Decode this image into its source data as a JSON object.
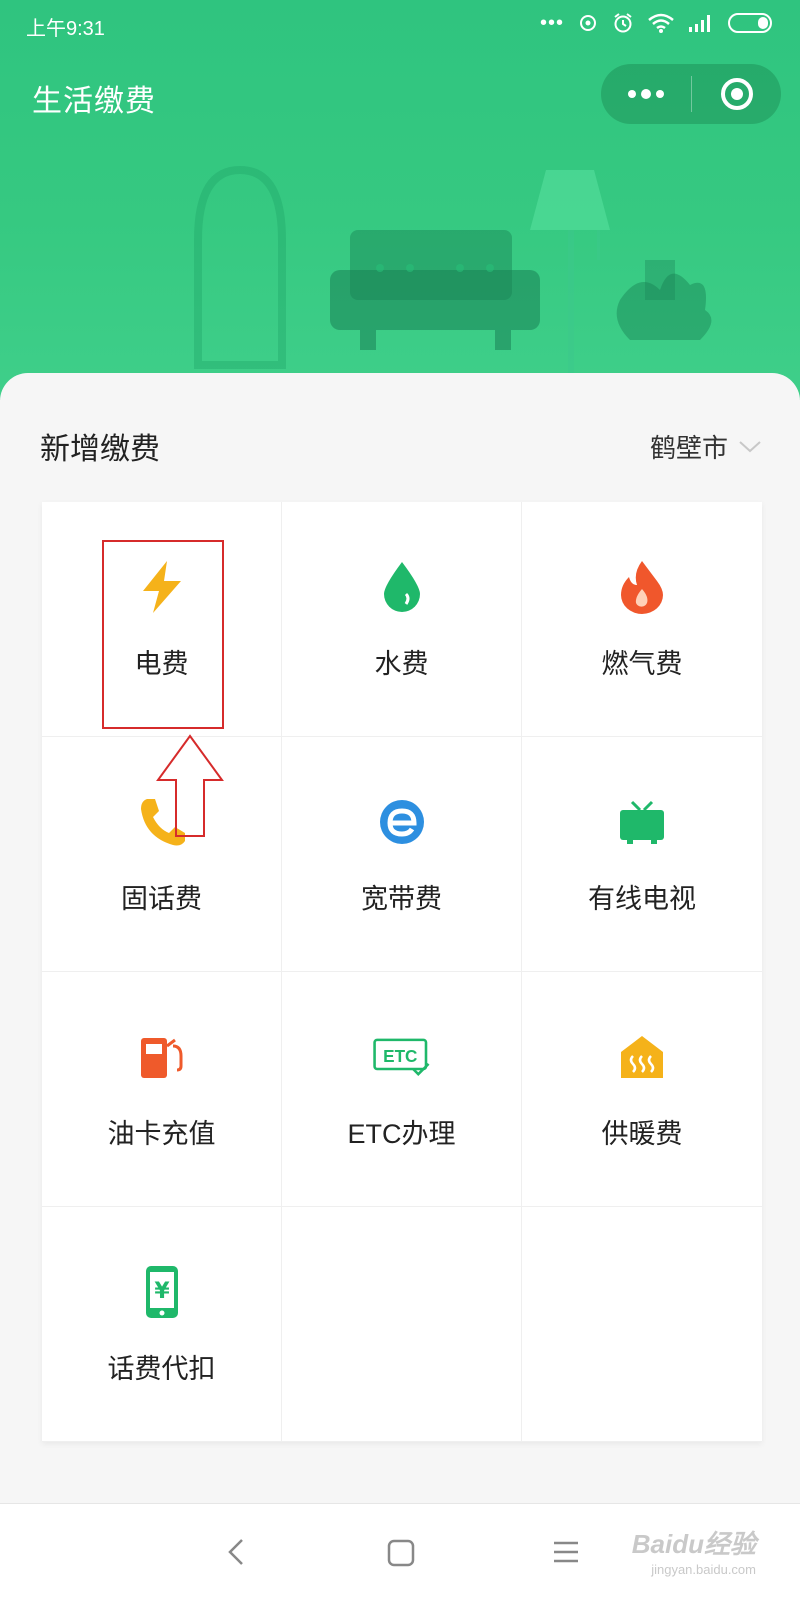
{
  "status_bar": {
    "time": "上午9:31",
    "icons": [
      "signal-dots-icon",
      "sync-icon",
      "alarm-icon",
      "wifi-icon",
      "cell-signal-icon",
      "battery-icon"
    ]
  },
  "header": {
    "title": "生活缴费",
    "capsule": {
      "more_icon": "more-dots-icon",
      "close_icon": "target-close-icon"
    }
  },
  "section": {
    "title": "新增缴费",
    "city": "鹤壁市"
  },
  "services": [
    {
      "label": "电费",
      "icon": "lightning-icon",
      "color": "#f5b21a"
    },
    {
      "label": "水费",
      "icon": "water-drop-icon",
      "color": "#1fb86a"
    },
    {
      "label": "燃气费",
      "icon": "flame-icon",
      "color": "#f0572c"
    },
    {
      "label": "固话费",
      "icon": "phone-icon",
      "color": "#f5b21a"
    },
    {
      "label": "宽带费",
      "icon": "browser-e-icon",
      "color": "#2d8fe0"
    },
    {
      "label": "有线电视",
      "icon": "tv-icon",
      "color": "#1fb86a"
    },
    {
      "label": "油卡充值",
      "icon": "fuel-pump-icon",
      "color": "#ef5a2b"
    },
    {
      "label": "ETC办理",
      "icon": "etc-icon",
      "color": "#1fb86a"
    },
    {
      "label": "供暖费",
      "icon": "heating-icon",
      "color": "#f5b21a"
    },
    {
      "label": "话费代扣",
      "icon": "mobile-yen-icon",
      "color": "#1fb86a"
    }
  ],
  "nav": {
    "back_icon": "back-chevron-icon",
    "home_icon": "home-square-icon",
    "menu_icon": "menu-lines-icon"
  },
  "watermark": {
    "text": "Baidu经验",
    "sub": "jingyan.baidu.com"
  },
  "colors": {
    "brand_green": "#2fc47f",
    "highlight_red": "#d62b2b"
  }
}
